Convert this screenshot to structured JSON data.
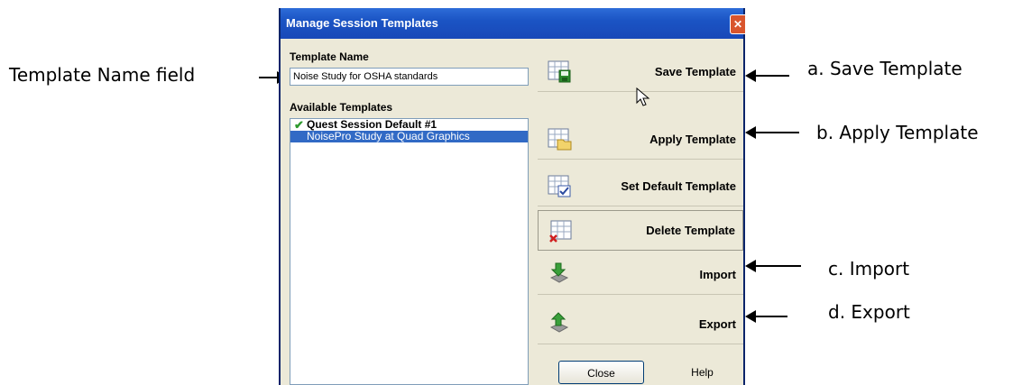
{
  "callouts": {
    "name_field": "Template Name field",
    "save": "a. Save Template",
    "apply": "b. Apply Template",
    "import": "c. Import",
    "export": "d. Export"
  },
  "dialog": {
    "title": "Manage Session Templates",
    "close_glyph": "✕",
    "template_name_label": "Template Name",
    "template_name_value": "Noise Study for OSHA standards",
    "available_label": "Available Templates",
    "templates": [
      {
        "label": "Quest Session Default #1",
        "default": true
      },
      {
        "label": "NoisePro Study at Quad Graphics",
        "selected": true
      }
    ],
    "buttons": {
      "save": "Save Template",
      "apply": "Apply Template",
      "set_default": "Set Default Template",
      "delete": "Delete Template",
      "import": "Import",
      "export": "Export"
    },
    "close_label": "Close",
    "help_label": "Help"
  },
  "icons": {
    "save": "save-grid-icon",
    "apply": "apply-folder-grid-icon",
    "set_default": "checkbox-grid-icon",
    "delete": "delete-grid-icon",
    "import": "import-arrow-icon",
    "export": "export-arrow-icon",
    "check": "checkmark-icon"
  },
  "colors": {
    "titlebar": "#1b54c4",
    "selection": "#316ac5",
    "dialog_bg": "#ece9d8",
    "check": "#2e9a2e"
  }
}
